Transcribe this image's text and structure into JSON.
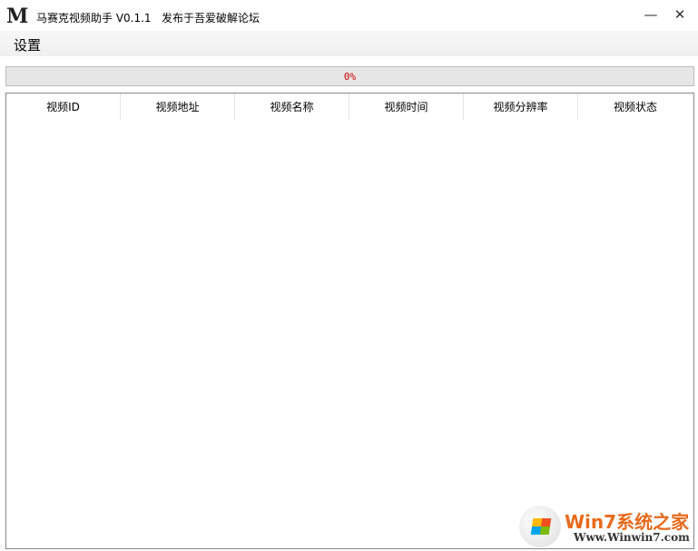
{
  "window": {
    "logo": "M",
    "title": "马赛克视频助手 V0.1.1   发布于吾爱破解论坛",
    "minimize": "—",
    "close": "✕"
  },
  "menu": {
    "items": [
      {
        "label": "设置"
      }
    ]
  },
  "progress": {
    "value": 0,
    "label": "0%",
    "fill_color": "#06b025",
    "text_color": "#cc0000"
  },
  "table": {
    "columns": [
      "视频ID",
      "视频地址",
      "视频名称",
      "视频时间",
      "视频分辨率",
      "视频状态"
    ],
    "rows": []
  },
  "watermark": {
    "line1": "Win7系统之家",
    "line2": "Www.Winwin7.com"
  }
}
